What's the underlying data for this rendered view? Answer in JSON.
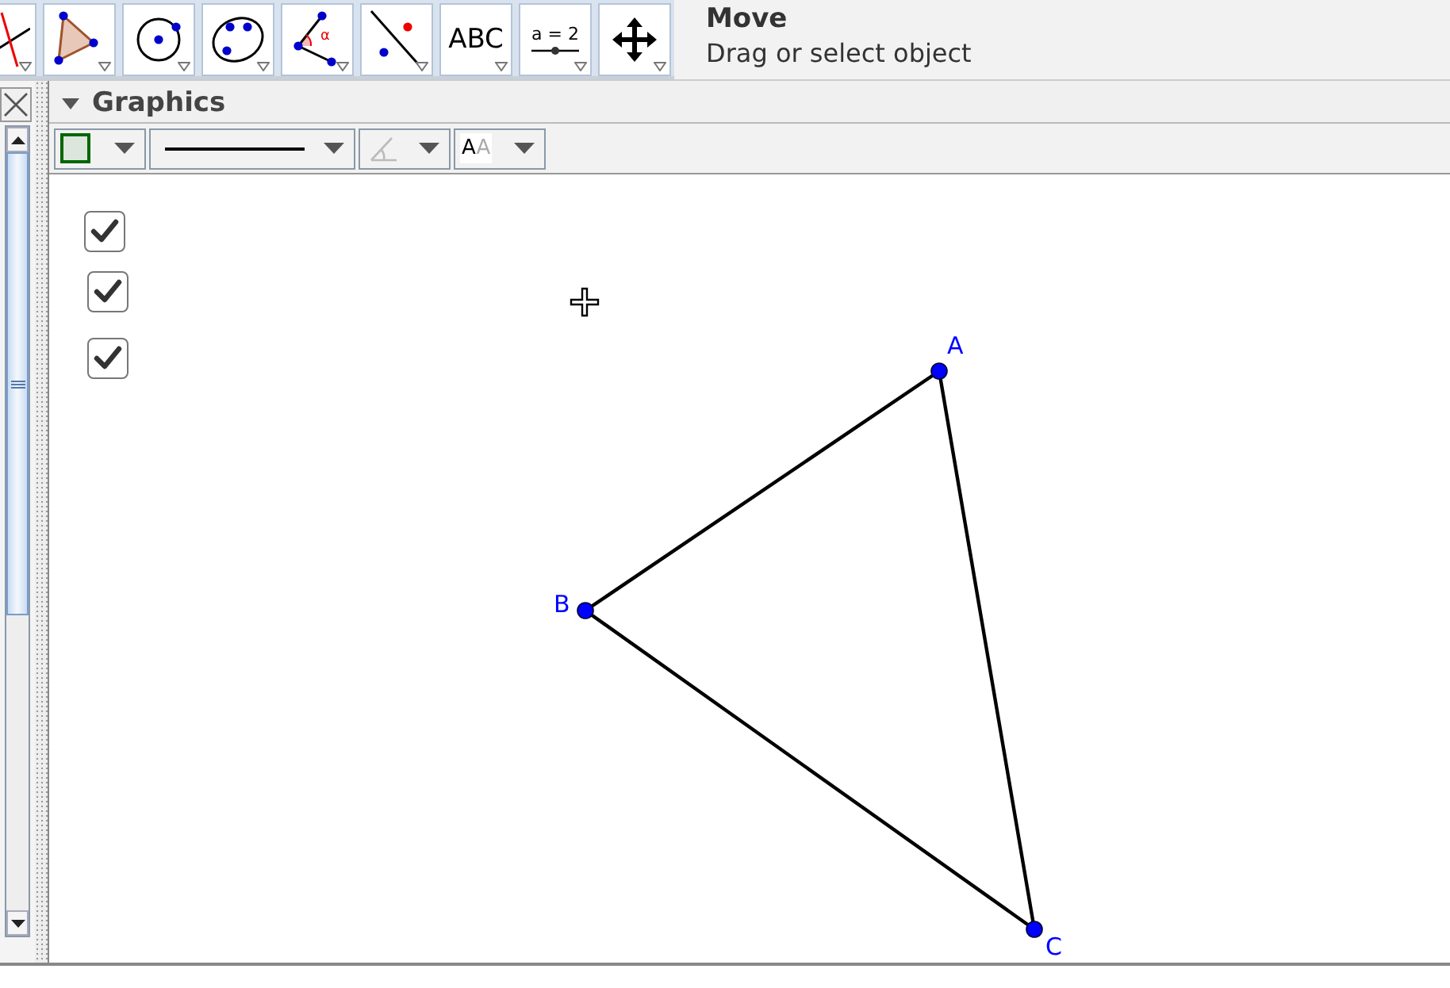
{
  "toolbar": {
    "tools": [
      {
        "kind": "line"
      },
      {
        "kind": "polygon"
      },
      {
        "kind": "circle"
      },
      {
        "kind": "conic"
      },
      {
        "kind": "angle",
        "label": "α"
      },
      {
        "kind": "reflect"
      },
      {
        "kind": "text",
        "label": "ABC"
      },
      {
        "kind": "slider",
        "label": "a = 2"
      },
      {
        "kind": "move"
      }
    ]
  },
  "tool_info": {
    "title": "Move",
    "description": "Drag or select object"
  },
  "graphics": {
    "title": "Graphics",
    "style_bar": [
      {
        "kind": "color"
      },
      {
        "kind": "line_style"
      },
      {
        "kind": "capture"
      },
      {
        "kind": "text_style",
        "label": "AA"
      }
    ],
    "checkboxes": [
      {
        "checked": true
      },
      {
        "checked": true
      },
      {
        "checked": true
      }
    ],
    "points": [
      {
        "label": "A"
      },
      {
        "label": "B"
      },
      {
        "label": "C"
      }
    ]
  }
}
